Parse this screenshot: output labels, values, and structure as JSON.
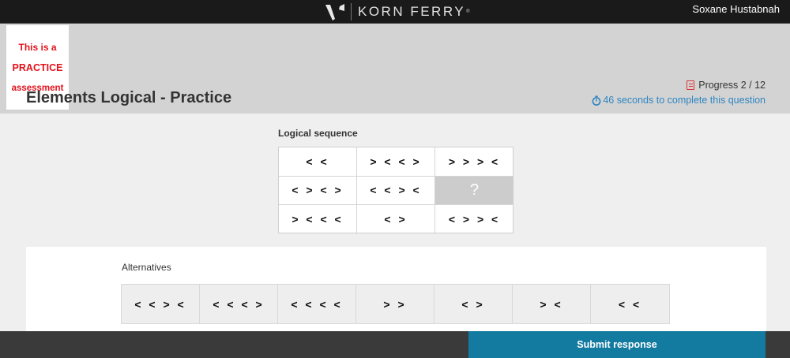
{
  "topbar": {
    "logo_text": "KORN FERRY",
    "logo_reg": "®",
    "user_name": "Soxane Hustabnah"
  },
  "practice_badge": {
    "line1": "This is a",
    "line2": "PRACTICE",
    "line3": "assessment"
  },
  "header": {
    "title": "Elements Logical - Practice",
    "progress_label": "Progress 2 / 12",
    "timer_text": "46 seconds to complete this question"
  },
  "sequence": {
    "label": "Logical sequence",
    "cells": [
      "< <",
      "> < < >",
      "> > > <",
      "< > < >",
      "< < > <",
      "?",
      "> < < <",
      "< >",
      "< > > <"
    ]
  },
  "alternatives": {
    "label": "Alternatives",
    "options": [
      "< < > <",
      "< < < >",
      "< < < <",
      "> >",
      "< >",
      "> <",
      "< <"
    ]
  },
  "footer": {
    "submit_label": "Submit response"
  },
  "colors": {
    "accent_blue": "#137aa0",
    "practice_red": "#e3111b",
    "timer_blue": "#2e86c1"
  }
}
